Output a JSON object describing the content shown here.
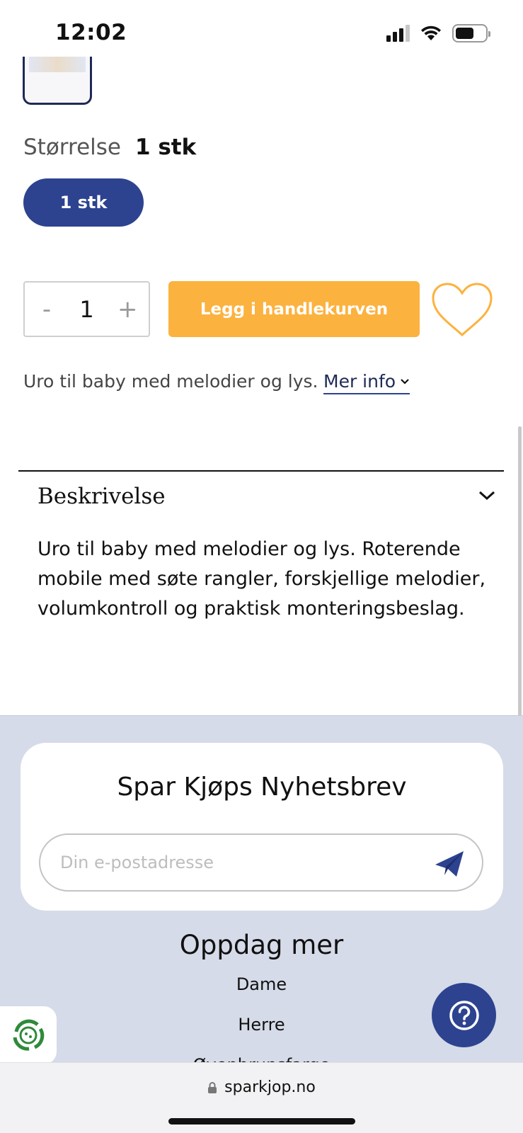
{
  "status_bar": {
    "time": "12:02"
  },
  "product": {
    "size_label": "Størrelse",
    "size_value": "1 stk",
    "size_option": "1 stk",
    "quantity": "1",
    "qty_minus": "-",
    "qty_plus": "+",
    "cart_button": "Legg i handlekurven",
    "short_description": "Uro til baby med melodier og lys.",
    "more_info": "Mer info"
  },
  "description": {
    "title": "Beskrivelse",
    "body": "Uro til baby med melodier og lys. Roterende mobile med søte rangler, forskjellige melodier, volumkontroll og praktisk monteringsbeslag."
  },
  "newsletter": {
    "title": "Spar Kjøps Nyhetsbrev",
    "placeholder": "Din e-postadresse"
  },
  "discover": {
    "title": "Oppdag mer",
    "links": [
      "Dame",
      "Herre",
      "Øvenbrunsfarge"
    ]
  },
  "browser": {
    "url": "sparkjop.no"
  },
  "colors": {
    "brand_blue": "#2d4390",
    "cart_orange": "#fcb23f",
    "footer_bg": "#d5dbe8"
  },
  "icons": {
    "heart": "heart-icon",
    "send": "paper-plane-icon",
    "help": "question-icon",
    "eco": "recycle-icon",
    "lock": "lock-icon",
    "chevron": "chevron-down-icon"
  }
}
